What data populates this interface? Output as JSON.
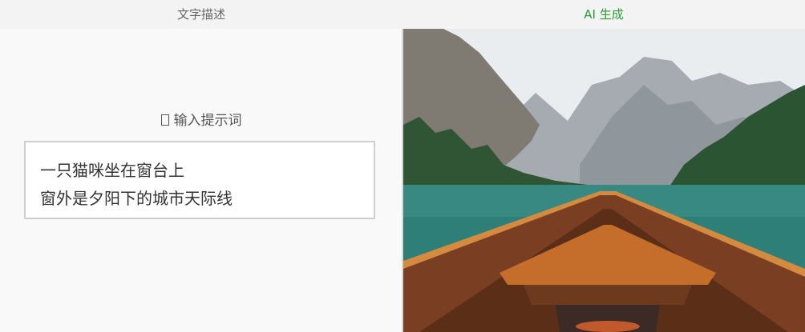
{
  "tabs": {
    "left_label": "文字描述",
    "right_label": "AI 生成"
  },
  "prompt": {
    "hint_label": "输入提示词",
    "hint_icon": "edit-icon",
    "text": "一只猫咪坐在窗台上\n窗外是夕阳下的城市天际线"
  },
  "image": {
    "subject": "boat-bow-on-mountain-lake",
    "colors": {
      "sky": "#e8ecef",
      "mountain": "#9aa0a5",
      "forest": "#2f5a37",
      "water": "#2f7f79",
      "wood": "#8b4a27"
    }
  }
}
